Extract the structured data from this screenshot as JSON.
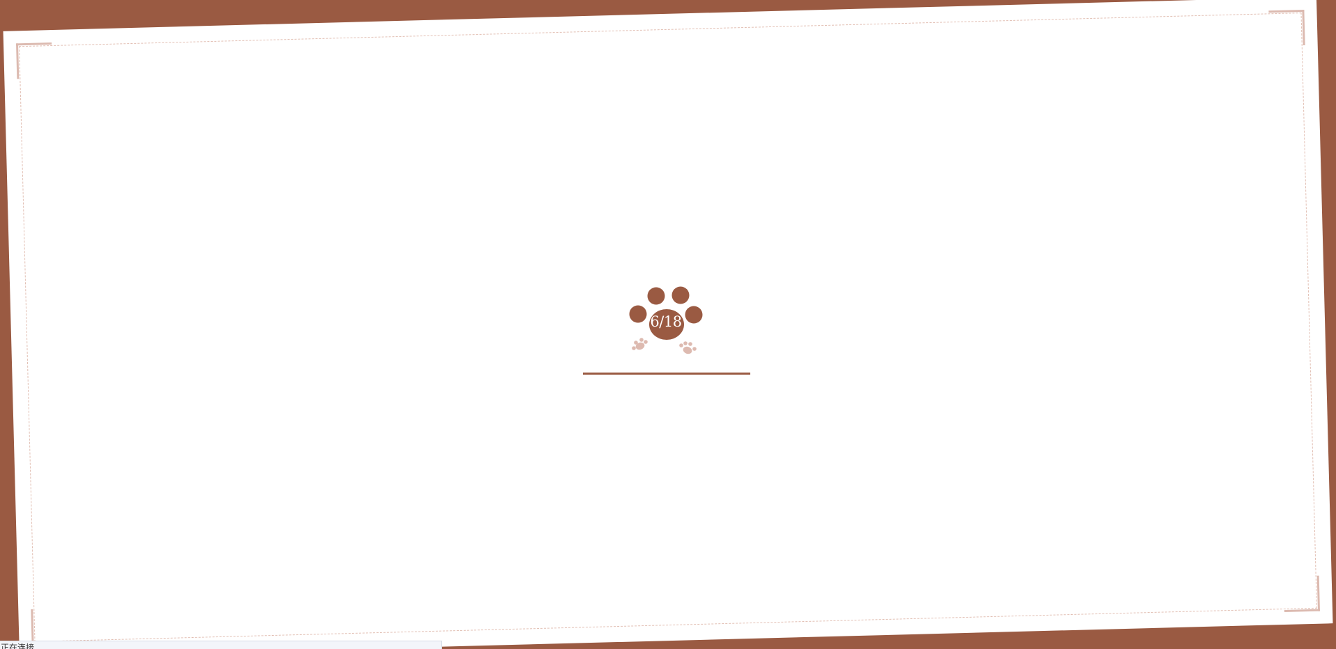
{
  "loader": {
    "counter_text": "6/18",
    "progress_fraction": 1.0
  },
  "status_bar": {
    "text": "正在连接..."
  },
  "colors": {
    "background": "#9a5a42",
    "paper": "#ffffff",
    "accent": "#9a5a42",
    "dashed_border": "#e2bfb3",
    "small_paw": "#ddbab0"
  },
  "icons": {
    "main": "paw-icon",
    "small": "paw-print-icon"
  }
}
